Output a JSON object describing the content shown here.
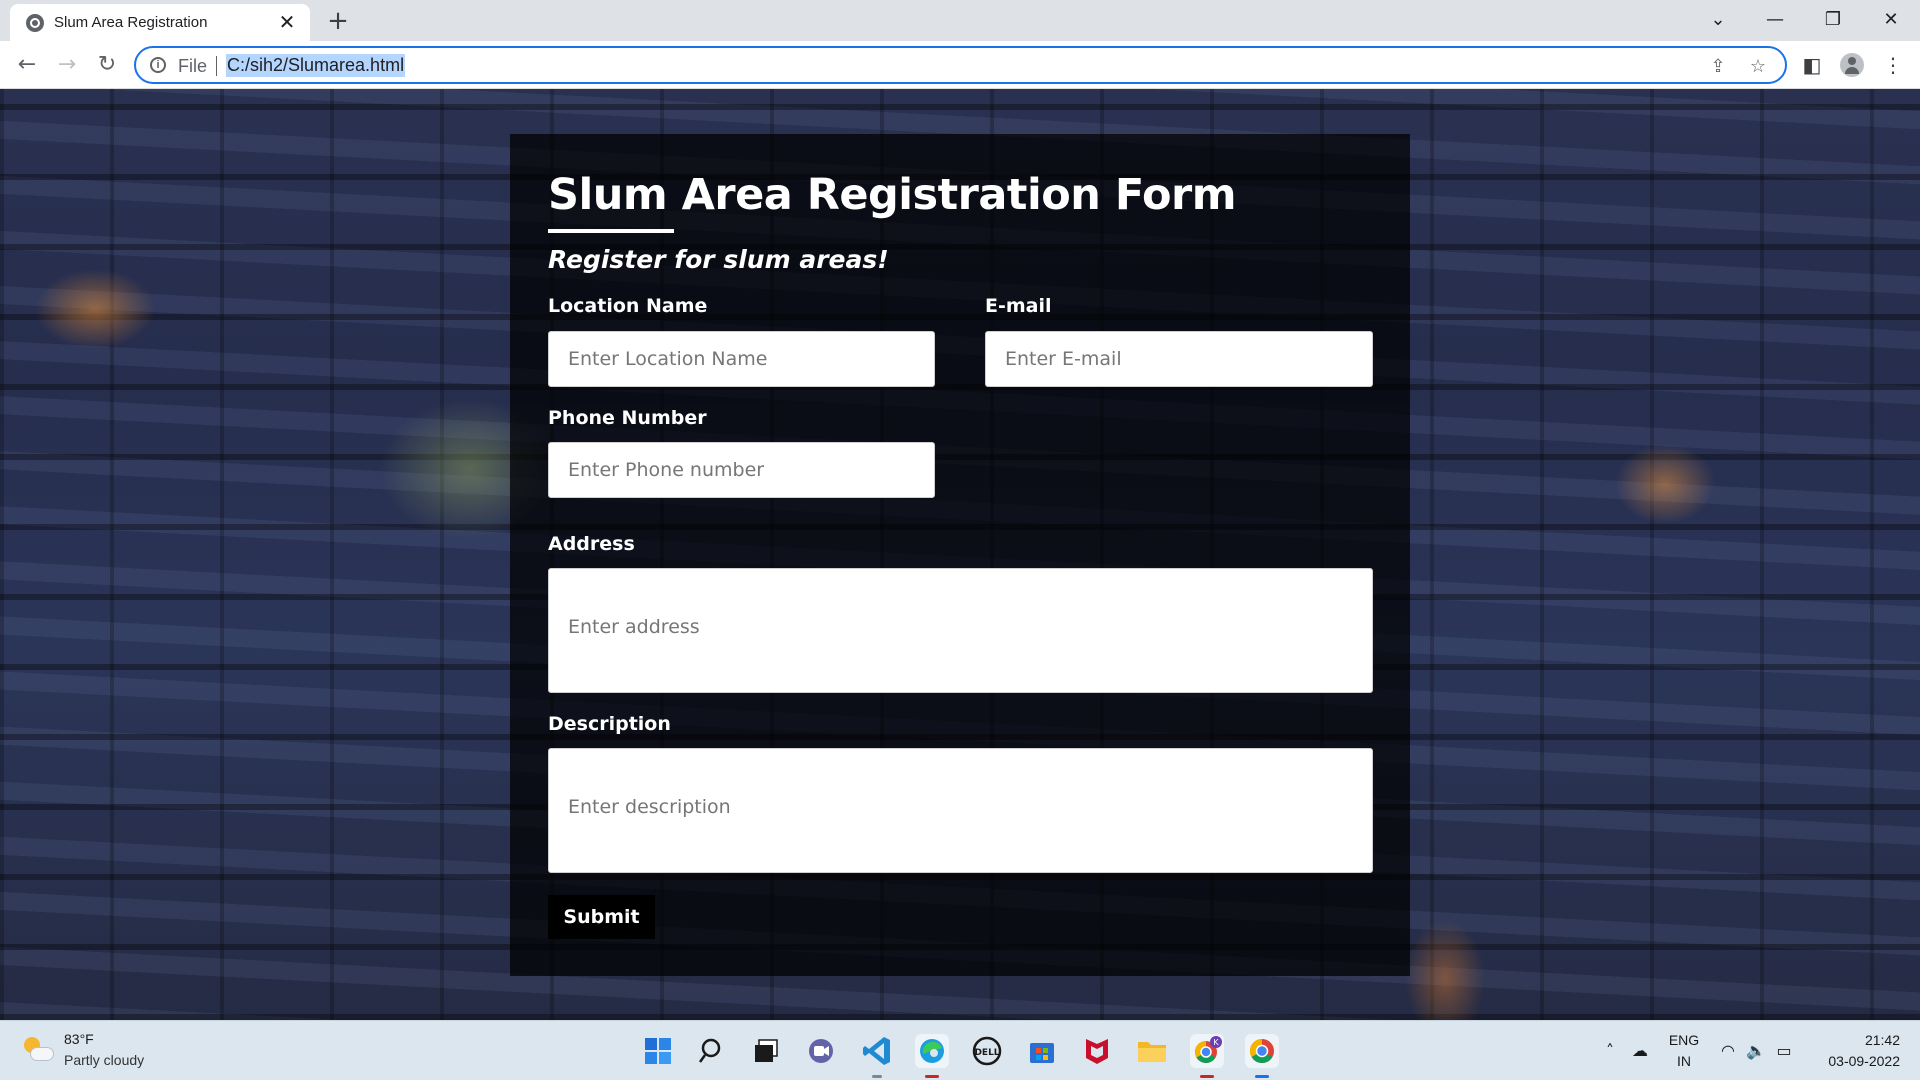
{
  "browser": {
    "tab_title": "Slum Area Registration",
    "tab_close": "✕",
    "new_tab": "+",
    "url_scheme": "File",
    "url": "C:/sih2/Slumarea.html"
  },
  "form": {
    "title": "Slum Area Registration Form",
    "subtitle": "Register for slum areas!",
    "location_label": "Location Name",
    "location_placeholder": "Enter Location Name",
    "email_label": "E-mail",
    "email_placeholder": "Enter E-mail",
    "phone_label": "Phone Number",
    "phone_placeholder": "Enter Phone number",
    "address_label": "Address",
    "address_placeholder": "Enter address",
    "description_label": "Description",
    "description_placeholder": "Enter description",
    "submit_label": "Submit"
  },
  "taskbar": {
    "weather_temp": "83°F",
    "weather_desc": "Partly cloudy",
    "apps": [
      "start-icon",
      "search-icon",
      "task-view-icon",
      "teams-chat-icon",
      "vscode-icon",
      "edge-icon",
      "dell-icon",
      "microsoft-store-icon",
      "mcafee-icon",
      "file-explorer-icon",
      "chrome-profile-icon",
      "chrome-icon"
    ],
    "language_line1": "ENG",
    "language_line2": "IN",
    "time": "21:42",
    "date": "03-09-2022"
  },
  "colors": {
    "accent": "#1a73e8",
    "panel_bg": "rgba(0,0,0,0.72)",
    "taskbar_bg": "#dbe6ef"
  }
}
